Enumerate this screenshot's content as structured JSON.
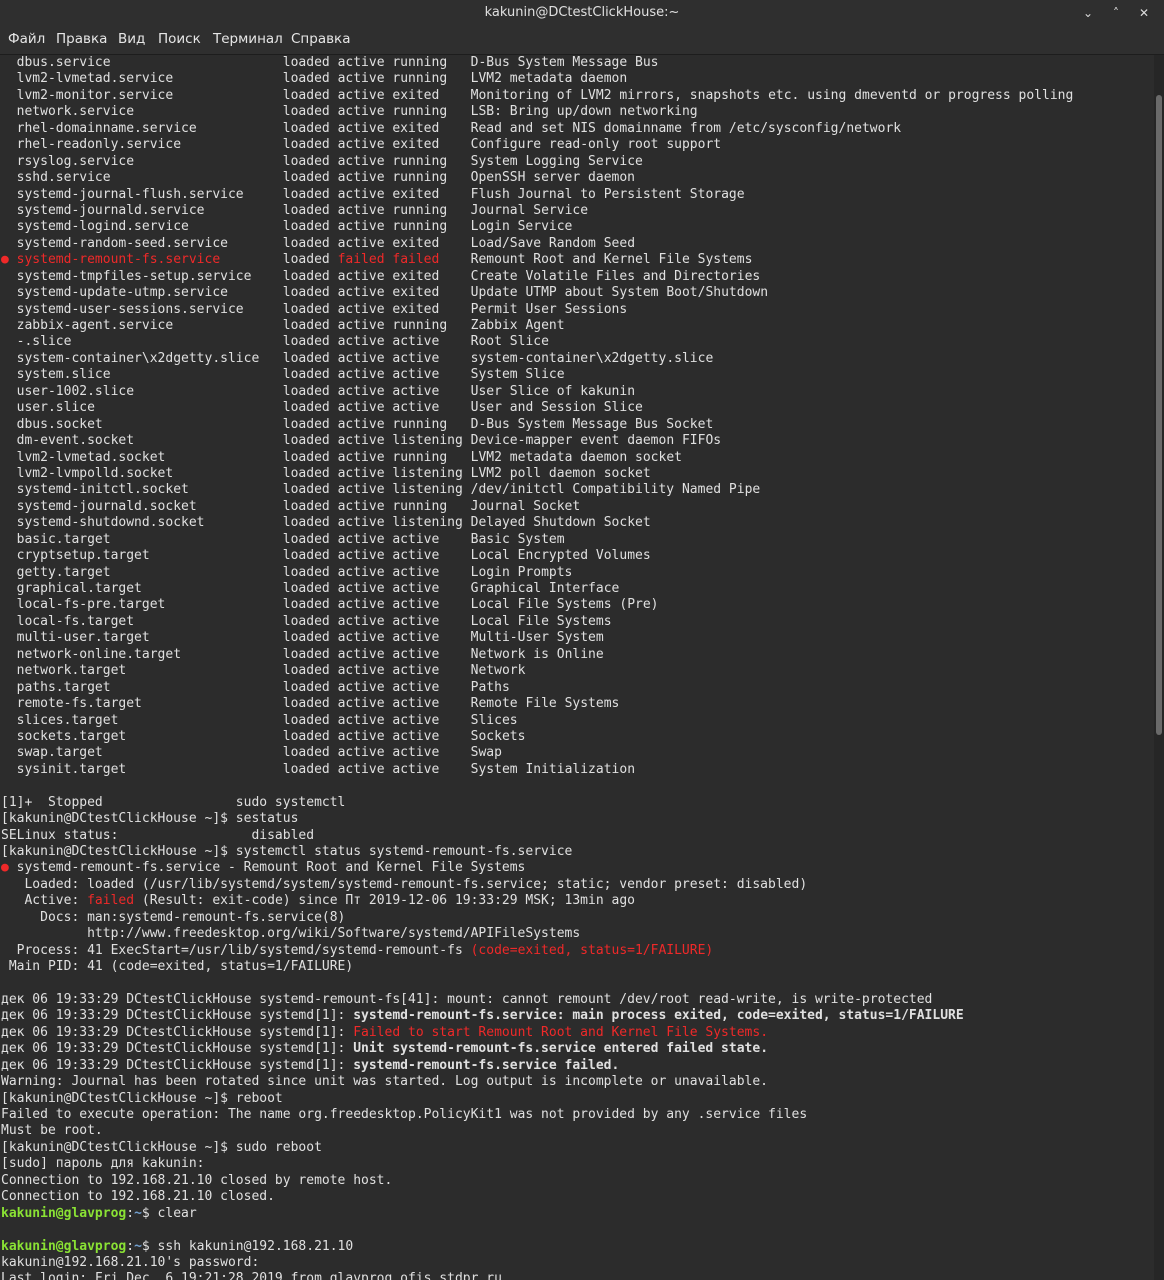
{
  "window": {
    "title": "kakunin@DCtestClickHouse:~",
    "buttons": [
      "⌄",
      "˄",
      "✕"
    ]
  },
  "menu": [
    "Файл",
    "Правка",
    "Вид",
    "Поиск",
    "Терминал",
    "Справка"
  ],
  "terminal": {
    "units": [
      [
        "",
        "dbus.service",
        "loaded",
        "active",
        "running",
        "D-Bus System Message Bus"
      ],
      [
        "",
        "lvm2-lvmetad.service",
        "loaded",
        "active",
        "running",
        "LVM2 metadata daemon"
      ],
      [
        "",
        "lvm2-monitor.service",
        "loaded",
        "active",
        "exited",
        "Monitoring of LVM2 mirrors, snapshots etc. using dmeventd or progress polling"
      ],
      [
        "",
        "network.service",
        "loaded",
        "active",
        "running",
        "LSB: Bring up/down networking"
      ],
      [
        "",
        "rhel-domainname.service",
        "loaded",
        "active",
        "exited",
        "Read and set NIS domainname from /etc/sysconfig/network"
      ],
      [
        "",
        "rhel-readonly.service",
        "loaded",
        "active",
        "exited",
        "Configure read-only root support"
      ],
      [
        "",
        "rsyslog.service",
        "loaded",
        "active",
        "running",
        "System Logging Service"
      ],
      [
        "",
        "sshd.service",
        "loaded",
        "active",
        "running",
        "OpenSSH server daemon"
      ],
      [
        "",
        "systemd-journal-flush.service",
        "loaded",
        "active",
        "exited",
        "Flush Journal to Persistent Storage"
      ],
      [
        "",
        "systemd-journald.service",
        "loaded",
        "active",
        "running",
        "Journal Service"
      ],
      [
        "",
        "systemd-logind.service",
        "loaded",
        "active",
        "running",
        "Login Service"
      ],
      [
        "",
        "systemd-random-seed.service",
        "loaded",
        "active",
        "exited",
        "Load/Save Random Seed"
      ],
      [
        "●",
        "systemd-remount-fs.service",
        "loaded",
        "failed",
        "failed",
        "Remount Root and Kernel File Systems"
      ],
      [
        "",
        "systemd-tmpfiles-setup.service",
        "loaded",
        "active",
        "exited",
        "Create Volatile Files and Directories"
      ],
      [
        "",
        "systemd-update-utmp.service",
        "loaded",
        "active",
        "exited",
        "Update UTMP about System Boot/Shutdown"
      ],
      [
        "",
        "systemd-user-sessions.service",
        "loaded",
        "active",
        "exited",
        "Permit User Sessions"
      ],
      [
        "",
        "zabbix-agent.service",
        "loaded",
        "active",
        "running",
        "Zabbix Agent"
      ],
      [
        "",
        "-.slice",
        "loaded",
        "active",
        "active",
        "Root Slice"
      ],
      [
        "",
        "system-container\\x2dgetty.slice",
        "loaded",
        "active",
        "active",
        "system-container\\x2dgetty.slice"
      ],
      [
        "",
        "system.slice",
        "loaded",
        "active",
        "active",
        "System Slice"
      ],
      [
        "",
        "user-1002.slice",
        "loaded",
        "active",
        "active",
        "User Slice of kakunin"
      ],
      [
        "",
        "user.slice",
        "loaded",
        "active",
        "active",
        "User and Session Slice"
      ],
      [
        "",
        "dbus.socket",
        "loaded",
        "active",
        "running",
        "D-Bus System Message Bus Socket"
      ],
      [
        "",
        "dm-event.socket",
        "loaded",
        "active",
        "listening",
        "Device-mapper event daemon FIFOs"
      ],
      [
        "",
        "lvm2-lvmetad.socket",
        "loaded",
        "active",
        "running",
        "LVM2 metadata daemon socket"
      ],
      [
        "",
        "lvm2-lvmpolld.socket",
        "loaded",
        "active",
        "listening",
        "LVM2 poll daemon socket"
      ],
      [
        "",
        "systemd-initctl.socket",
        "loaded",
        "active",
        "listening",
        "/dev/initctl Compatibility Named Pipe"
      ],
      [
        "",
        "systemd-journald.socket",
        "loaded",
        "active",
        "running",
        "Journal Socket"
      ],
      [
        "",
        "systemd-shutdownd.socket",
        "loaded",
        "active",
        "listening",
        "Delayed Shutdown Socket"
      ],
      [
        "",
        "basic.target",
        "loaded",
        "active",
        "active",
        "Basic System"
      ],
      [
        "",
        "cryptsetup.target",
        "loaded",
        "active",
        "active",
        "Local Encrypted Volumes"
      ],
      [
        "",
        "getty.target",
        "loaded",
        "active",
        "active",
        "Login Prompts"
      ],
      [
        "",
        "graphical.target",
        "loaded",
        "active",
        "active",
        "Graphical Interface"
      ],
      [
        "",
        "local-fs-pre.target",
        "loaded",
        "active",
        "active",
        "Local File Systems (Pre)"
      ],
      [
        "",
        "local-fs.target",
        "loaded",
        "active",
        "active",
        "Local File Systems"
      ],
      [
        "",
        "multi-user.target",
        "loaded",
        "active",
        "active",
        "Multi-User System"
      ],
      [
        "",
        "network-online.target",
        "loaded",
        "active",
        "active",
        "Network is Online"
      ],
      [
        "",
        "network.target",
        "loaded",
        "active",
        "active",
        "Network"
      ],
      [
        "",
        "paths.target",
        "loaded",
        "active",
        "active",
        "Paths"
      ],
      [
        "",
        "remote-fs.target",
        "loaded",
        "active",
        "active",
        "Remote File Systems"
      ],
      [
        "",
        "slices.target",
        "loaded",
        "active",
        "active",
        "Slices"
      ],
      [
        "",
        "sockets.target",
        "loaded",
        "active",
        "active",
        "Sockets"
      ],
      [
        "",
        "swap.target",
        "loaded",
        "active",
        "active",
        "Swap"
      ],
      [
        "",
        "sysinit.target",
        "loaded",
        "active",
        "active",
        "System Initialization"
      ]
    ],
    "lines": [
      [
        {
          "t": ""
        }
      ],
      [
        {
          "t": "[1]+  Stopped                 sudo systemctl"
        }
      ],
      [
        {
          "t": "[kakunin@DCtestClickHouse ~]$ sestatus"
        }
      ],
      [
        {
          "t": "SELinux status:                 disabled"
        }
      ],
      [
        {
          "t": "[kakunin@DCtestClickHouse ~]$ systemctl status systemd-remount-fs.service"
        }
      ],
      [
        {
          "t": "●",
          "c": "red"
        },
        {
          "t": " systemd-remount-fs.service - Remount Root and Kernel File Systems"
        }
      ],
      [
        {
          "t": "   Loaded: loaded (/usr/lib/systemd/system/systemd-remount-fs.service; static; vendor preset: disabled)"
        }
      ],
      [
        {
          "t": "   Active: "
        },
        {
          "t": "failed",
          "c": "red"
        },
        {
          "t": " (Result: exit-code) since Пт 2019-12-06 19:33:29 MSK; 13min ago"
        }
      ],
      [
        {
          "t": "     Docs: man:systemd-remount-fs.service(8)"
        }
      ],
      [
        {
          "t": "           http://www.freedesktop.org/wiki/Software/systemd/APIFileSystems"
        }
      ],
      [
        {
          "t": "  Process: 41 ExecStart=/usr/lib/systemd/systemd-remount-fs "
        },
        {
          "t": "(code=exited, status=1/FAILURE)",
          "c": "red"
        }
      ],
      [
        {
          "t": " Main PID: 41 (code=exited, status=1/FAILURE)"
        }
      ],
      [
        {
          "t": ""
        }
      ],
      [
        {
          "t": "дек 06 19:33:29 DCtestClickHouse systemd-remount-fs[41]: mount: cannot remount /dev/root read-write, is write-protected"
        }
      ],
      [
        {
          "t": "дек 06 19:33:29 DCtestClickHouse systemd[1]: "
        },
        {
          "t": "systemd-remount-fs.service: main process exited, code=exited, status=1/FAILURE",
          "c": "b"
        }
      ],
      [
        {
          "t": "дек 06 19:33:29 DCtestClickHouse systemd[1]: "
        },
        {
          "t": "Failed to start Remount Root and Kernel File Systems.",
          "c": "red"
        }
      ],
      [
        {
          "t": "дек 06 19:33:29 DCtestClickHouse systemd[1]: "
        },
        {
          "t": "Unit systemd-remount-fs.service entered failed state.",
          "c": "b"
        }
      ],
      [
        {
          "t": "дек 06 19:33:29 DCtestClickHouse systemd[1]: "
        },
        {
          "t": "systemd-remount-fs.service failed.",
          "c": "b"
        }
      ],
      [
        {
          "t": "Warning: Journal has been rotated since unit was started. Log output is incomplete or unavailable."
        }
      ],
      [
        {
          "t": "[kakunin@DCtestClickHouse ~]$ reboot"
        }
      ],
      [
        {
          "t": "Failed to execute operation: The name org.freedesktop.PolicyKit1 was not provided by any .service files"
        }
      ],
      [
        {
          "t": "Must be root."
        }
      ],
      [
        {
          "t": "[kakunin@DCtestClickHouse ~]$ sudo reboot"
        }
      ],
      [
        {
          "t": "[sudo] пароль для kakunin:"
        }
      ],
      [
        {
          "t": "Connection to 192.168.21.10 closed by remote host."
        }
      ],
      [
        {
          "t": "Connection to 192.168.21.10 closed."
        }
      ],
      [
        {
          "t": "kakunin@glavprog",
          "c": "g"
        },
        {
          "t": ":"
        },
        {
          "t": "~",
          "c": "bl"
        },
        {
          "t": "$ clear"
        }
      ],
      [
        {
          "t": ""
        }
      ],
      [
        {
          "t": "kakunin@glavprog",
          "c": "g"
        },
        {
          "t": ":"
        },
        {
          "t": "~",
          "c": "bl"
        },
        {
          "t": "$ ssh kakunin@192.168.21.10"
        }
      ],
      [
        {
          "t": "kakunin@192.168.21.10's password:"
        }
      ],
      [
        {
          "t": "Last login: Fri Dec  6 19:21:28 2019 from glavprog.ofis.stdpr.ru"
        }
      ]
    ]
  }
}
